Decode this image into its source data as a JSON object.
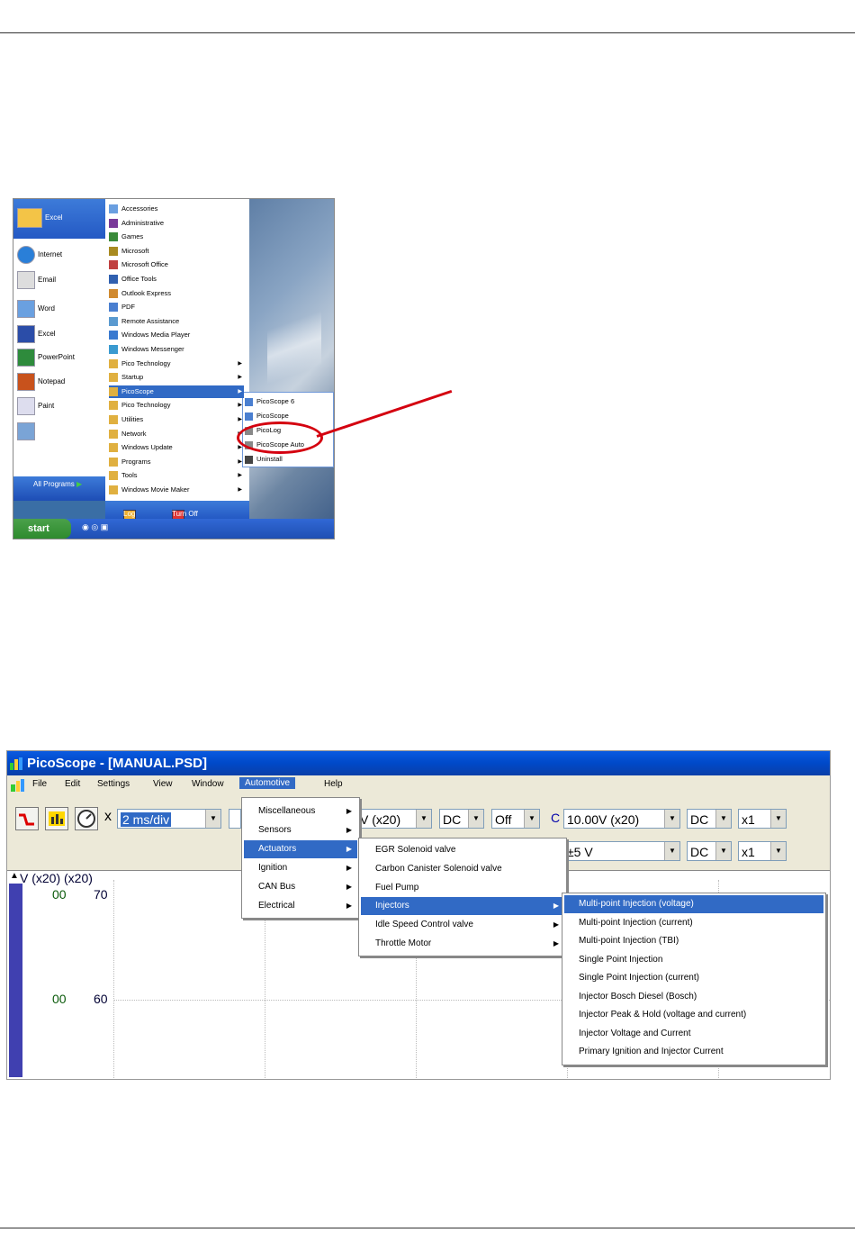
{
  "startmenu": {
    "pinned": [
      "Excel",
      "Internet",
      "Email",
      "Word",
      "Excel",
      "PowerPoint",
      "Notepad",
      "Paint"
    ],
    "all_programs": "All Programs",
    "programs": [
      "Accessories",
      "Administrative",
      "Games",
      "Microsoft",
      "Microsoft Office",
      "Office Tools",
      "Outlook Express",
      "PDF",
      "Remote Assistance",
      "Windows Media Player",
      "Windows Messenger",
      "Pico Technology",
      "Startup",
      "PicoScope",
      "Pico Technology",
      "Utilities",
      "Network",
      "Windows Update",
      "Programs",
      "Tools",
      "Windows Movie Maker"
    ],
    "submenu": [
      "PicoScope 6",
      "PicoScope",
      "PicoLog",
      "PicoScope Auto",
      "Uninstall"
    ],
    "start_label": "start",
    "bottom": [
      "Log Off",
      "Turn Off Computer"
    ]
  },
  "picoscope": {
    "title": "PicoScope - [MANUAL.PSD]",
    "menubar": [
      "File",
      "Edit",
      "Settings",
      "View",
      "Window",
      "Automotive",
      "Help"
    ],
    "timebase": "2 ms/div",
    "channel_a_range": "V (x20)",
    "channel_a_coupling": "DC",
    "channel_a_filter": "Off",
    "channel_c_label": "C",
    "channel_c_range": "10.00V (x20)",
    "channel_c_coupling": "DC",
    "channel_c_mult": "x1",
    "row2_range": "±5 V",
    "row2_coupling": "DC",
    "row2_mult": "x1",
    "x_label": "x",
    "axis_header": "V (x20) (x20)",
    "y_labels": [
      "00",
      "70",
      "00",
      "60"
    ],
    "menu_auto": [
      "Miscellaneous",
      "Sensors",
      "Actuators",
      "Ignition",
      "CAN Bus",
      "Electrical"
    ],
    "menu_actuators": [
      "EGR Solenoid valve",
      "Carbon Canister Solenoid valve",
      "Fuel Pump",
      "Injectors",
      "Idle Speed Control valve",
      "Throttle Motor"
    ],
    "menu_injectors": [
      "Multi-point Injection (voltage)",
      "Multi-point Injection (current)",
      "Multi-point Injection (TBI)",
      "Single Point Injection",
      "Single Point Injection (current)",
      "Injector Bosch Diesel (Bosch)",
      "Injector Peak & Hold (voltage and current)",
      "Injector Voltage and Current",
      "Primary Ignition and Injector Current"
    ]
  },
  "colors": {
    "highlight": "#316ac5",
    "annotation": "#d4000f",
    "titlebar": "#0a5ae0"
  }
}
